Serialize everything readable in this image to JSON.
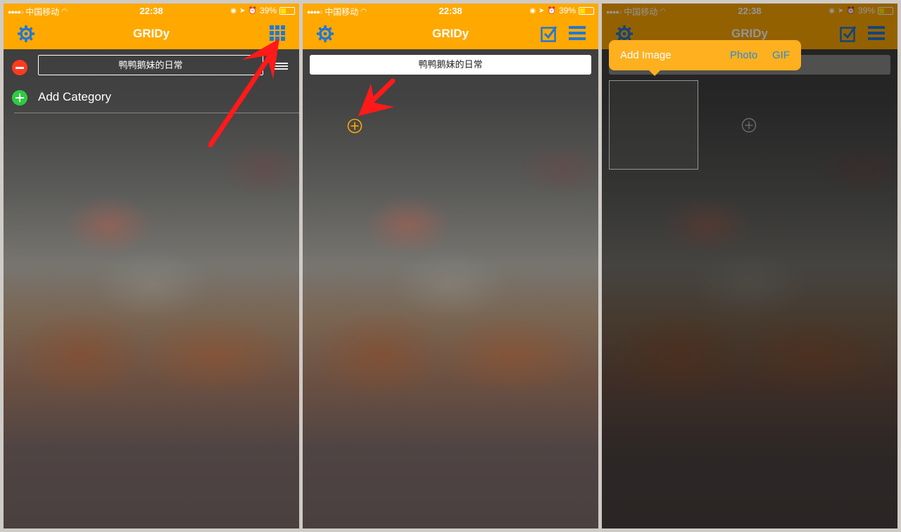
{
  "status_bar": {
    "carrier": "中国移动",
    "time": "22:38",
    "battery": "39%"
  },
  "app": {
    "title": "GRIDy"
  },
  "category_name": "鸭鸭鹅妹的日常",
  "panel1": {
    "add_category_label": "Add Category"
  },
  "popover": {
    "title": "Add Image",
    "photo_label": "Photo",
    "gif_label": "GIF"
  },
  "colors": {
    "accent": "#ffa800",
    "link_blue": "#2a8bd8",
    "delete_red": "#ff3b1f",
    "add_green": "#2ecc40",
    "arrow_red": "#ff1a1a"
  },
  "icons": [
    "gear-icon",
    "grid-icon",
    "checkbox-icon",
    "list-icon",
    "plus-circle-icon",
    "minus-circle-icon",
    "wifi-icon",
    "battery-icon"
  ]
}
